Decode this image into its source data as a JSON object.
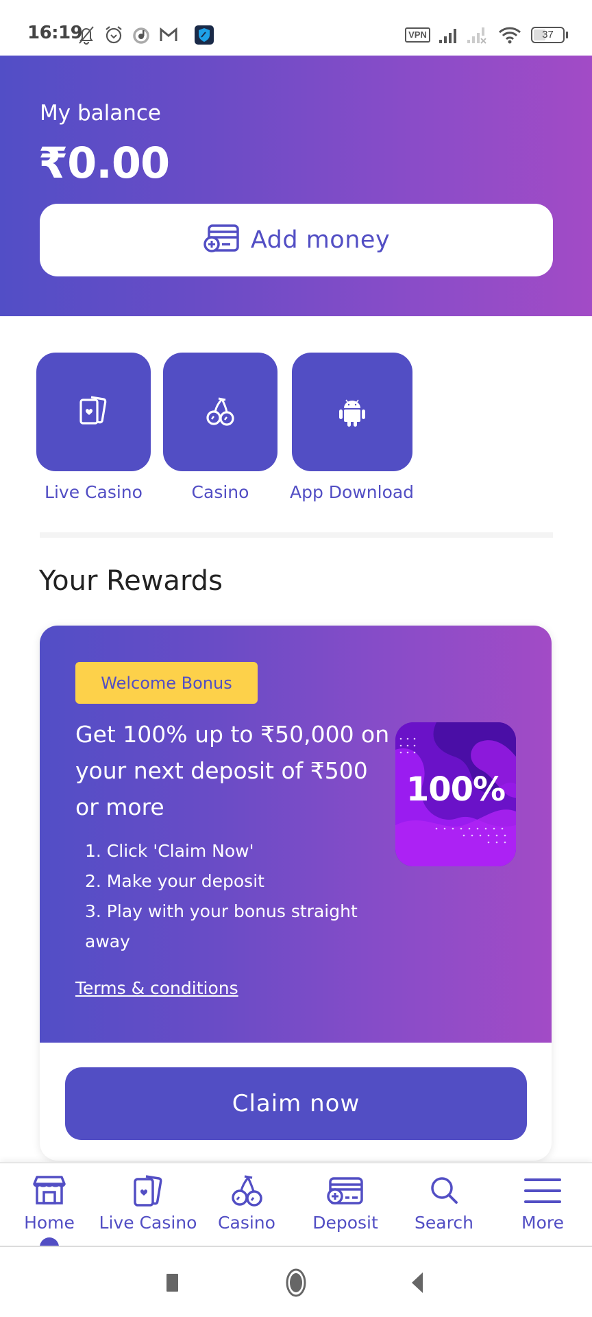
{
  "status_bar": {
    "time": "16:19",
    "left_icons": [
      "bell-off-icon",
      "alarm-icon",
      "music-app-icon",
      "gmail-icon",
      "vpn-app-icon"
    ],
    "vpn_label": "VPN",
    "battery_level": "37"
  },
  "header": {
    "balance_label": "My balance",
    "balance_value": "₹0.00",
    "add_money_label": "Add money"
  },
  "quick_links": [
    {
      "label": "Live Casino",
      "icon": "cards-icon"
    },
    {
      "label": "Casino",
      "icon": "cherry-icon"
    },
    {
      "label": "App Download",
      "icon": "android-icon"
    }
  ],
  "rewards": {
    "section_title": "Your Rewards",
    "badge": "Welcome Bonus",
    "headline": "Get 100% up to ₹50,000 on your next deposit of ₹500 or more",
    "steps": [
      "1. Click 'Claim Now'",
      "2. Make your deposit",
      "3. Play with your bonus straight away"
    ],
    "terms_label": "Terms & conditions",
    "promo_image_text": "100%",
    "claim_label": "Claim now"
  },
  "bottom_nav": {
    "active": "Home",
    "items": [
      {
        "label": "Home",
        "icon": "home-icon"
      },
      {
        "label": "Live Casino",
        "icon": "cards-icon"
      },
      {
        "label": "Casino",
        "icon": "cherry-icon"
      },
      {
        "label": "Deposit",
        "icon": "deposit-card-icon"
      },
      {
        "label": "Search",
        "icon": "search-icon"
      },
      {
        "label": "More",
        "icon": "menu-icon"
      }
    ]
  },
  "colors": {
    "brand": "#524ec4",
    "gradient_start": "#524ec6",
    "gradient_end": "#a24bc6",
    "badge": "#fdd14a"
  }
}
